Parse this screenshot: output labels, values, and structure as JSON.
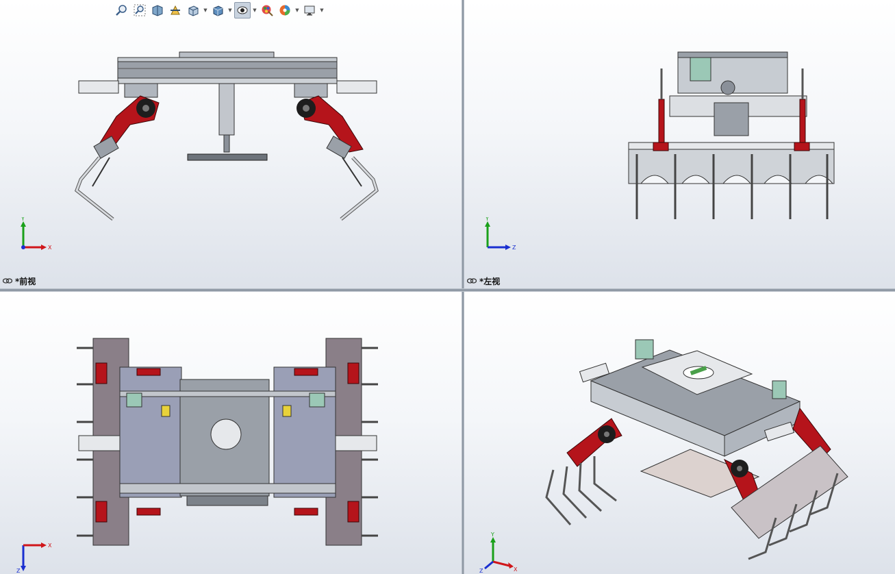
{
  "toolbar": {
    "items": [
      {
        "icon": "zoom-to-fit-icon"
      },
      {
        "icon": "zoom-to-area-icon"
      },
      {
        "icon": "previous-view-icon"
      },
      {
        "icon": "section-view-icon"
      },
      {
        "icon": "view-orientation-icon",
        "dropdown": true
      },
      {
        "icon": "display-style-icon",
        "dropdown": true
      },
      {
        "icon": "hide-show-items-icon",
        "dropdown": true,
        "active": true
      },
      {
        "icon": "edit-appearance-icon"
      },
      {
        "icon": "apply-scene-icon",
        "dropdown": true
      },
      {
        "icon": "view-settings-icon",
        "dropdown": true
      }
    ]
  },
  "viewports": {
    "top_left": {
      "label": "*前视",
      "axis1": "Y",
      "axis2": "X"
    },
    "top_right": {
      "label": "*左视",
      "axis1": "Y",
      "axis2": "Z"
    },
    "bottom_left": {
      "axis1": "Z",
      "axis2": "X"
    },
    "bottom_right": {
      "axis1": "Y",
      "axis2": "X",
      "axis3": "Z"
    }
  },
  "colors": {
    "accent_red": "#b5141b",
    "frame_gray": "#8a919b",
    "axis_x": "#d0161a",
    "axis_y": "#1aa01a",
    "axis_z": "#1a2fd0"
  }
}
